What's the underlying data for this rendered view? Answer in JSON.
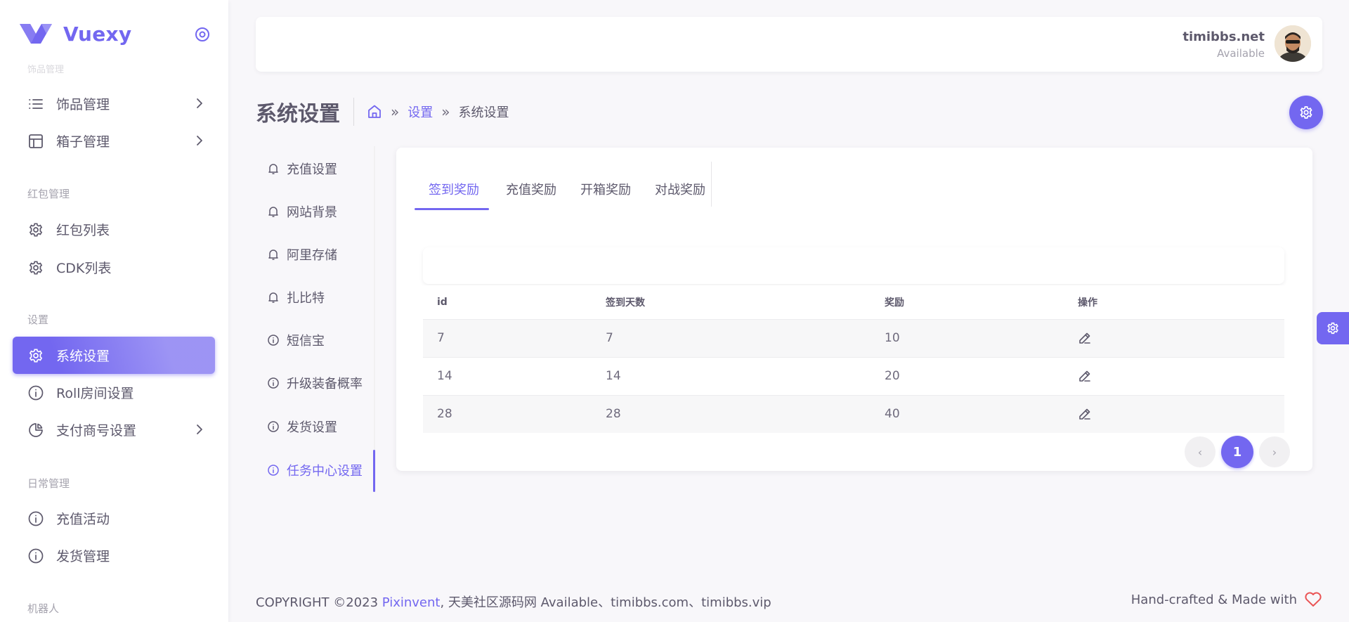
{
  "brand": {
    "name": "Vuexy"
  },
  "sidebar": {
    "faded_header": "饰品管理",
    "groups": [
      {
        "items": [
          {
            "label": "饰品管理",
            "icon": "list-icon",
            "has_children": true
          },
          {
            "label": "箱子管理",
            "icon": "layout-icon",
            "has_children": true
          }
        ]
      },
      {
        "header": "红包管理",
        "items": [
          {
            "label": "红包列表",
            "icon": "gear-icon"
          },
          {
            "label": "CDK列表",
            "icon": "gear-icon"
          }
        ]
      },
      {
        "header": "设置",
        "items": [
          {
            "label": "系统设置",
            "icon": "gear-icon",
            "active": true
          },
          {
            "label": "Roll房间设置",
            "icon": "info-icon"
          },
          {
            "label": "支付商号设置",
            "icon": "pie-chart-icon",
            "has_children": true
          }
        ]
      },
      {
        "header": "日常管理",
        "items": [
          {
            "label": "充值活动",
            "icon": "info-icon"
          },
          {
            "label": "发货管理",
            "icon": "info-icon"
          }
        ]
      },
      {
        "header": "机器人"
      }
    ]
  },
  "topbar": {
    "user_name": "timibbs.net",
    "user_status": "Available"
  },
  "page": {
    "title": "系统设置",
    "breadcrumb": {
      "link": "设置",
      "current": "系统设置",
      "separator": "»"
    }
  },
  "settings_menu": [
    {
      "label": "充值设置",
      "icon": "bell-icon"
    },
    {
      "label": "网站背景",
      "icon": "bell-icon"
    },
    {
      "label": "阿里存储",
      "icon": "bell-icon"
    },
    {
      "label": "扎比特",
      "icon": "bell-icon"
    },
    {
      "label": "短信宝",
      "icon": "info-icon"
    },
    {
      "label": "升级装备概率",
      "icon": "info-icon"
    },
    {
      "label": "发货设置",
      "icon": "info-icon"
    },
    {
      "label": "任务中心设置",
      "icon": "info-icon",
      "active": true
    }
  ],
  "tabs": [
    {
      "label": "签到奖励",
      "active": true
    },
    {
      "label": "充值奖励"
    },
    {
      "label": "开箱奖励"
    },
    {
      "label": "对战奖励"
    }
  ],
  "table": {
    "columns": [
      "id",
      "签到天数",
      "奖励",
      "操作"
    ],
    "rows": [
      [
        "7",
        "7",
        "10"
      ],
      [
        "14",
        "14",
        "20"
      ],
      [
        "28",
        "28",
        "40"
      ]
    ]
  },
  "pagination": {
    "current": "1",
    "prev": "‹",
    "next": "›"
  },
  "footer": {
    "left_prefix": "COPYRIGHT ©2023 ",
    "left_brand": "Pixinvent",
    "left_suffix": ", 天美社区源码网 Available、timibbs.com、timibbs.vip",
    "right": "Hand-crafted & Made with"
  },
  "colors": {
    "primary": "#7367f0",
    "danger": "#ea5455"
  }
}
